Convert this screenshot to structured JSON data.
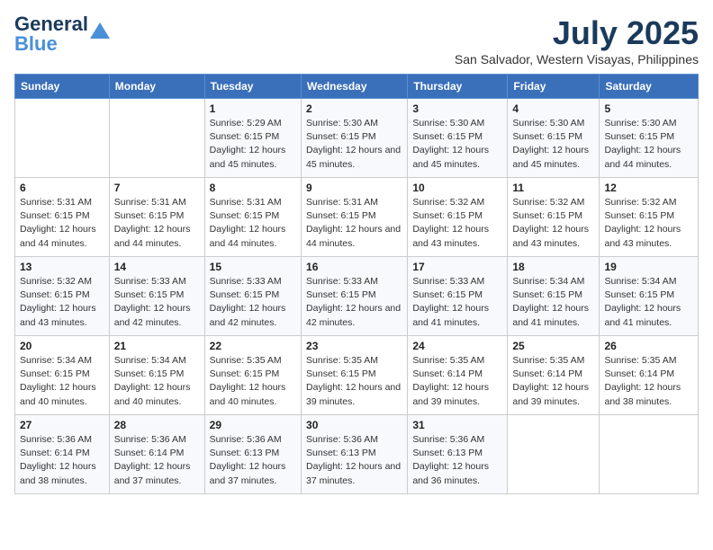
{
  "header": {
    "logo_line1": "General",
    "logo_line2": "Blue",
    "title": "July 2025",
    "subtitle": "San Salvador, Western Visayas, Philippines"
  },
  "calendar": {
    "columns": [
      "Sunday",
      "Monday",
      "Tuesday",
      "Wednesday",
      "Thursday",
      "Friday",
      "Saturday"
    ],
    "weeks": [
      [
        {
          "day": "",
          "info": ""
        },
        {
          "day": "",
          "info": ""
        },
        {
          "day": "1",
          "info": "Sunrise: 5:29 AM\nSunset: 6:15 PM\nDaylight: 12 hours and 45 minutes."
        },
        {
          "day": "2",
          "info": "Sunrise: 5:30 AM\nSunset: 6:15 PM\nDaylight: 12 hours and 45 minutes."
        },
        {
          "day": "3",
          "info": "Sunrise: 5:30 AM\nSunset: 6:15 PM\nDaylight: 12 hours and 45 minutes."
        },
        {
          "day": "4",
          "info": "Sunrise: 5:30 AM\nSunset: 6:15 PM\nDaylight: 12 hours and 45 minutes."
        },
        {
          "day": "5",
          "info": "Sunrise: 5:30 AM\nSunset: 6:15 PM\nDaylight: 12 hours and 44 minutes."
        }
      ],
      [
        {
          "day": "6",
          "info": "Sunrise: 5:31 AM\nSunset: 6:15 PM\nDaylight: 12 hours and 44 minutes."
        },
        {
          "day": "7",
          "info": "Sunrise: 5:31 AM\nSunset: 6:15 PM\nDaylight: 12 hours and 44 minutes."
        },
        {
          "day": "8",
          "info": "Sunrise: 5:31 AM\nSunset: 6:15 PM\nDaylight: 12 hours and 44 minutes."
        },
        {
          "day": "9",
          "info": "Sunrise: 5:31 AM\nSunset: 6:15 PM\nDaylight: 12 hours and 44 minutes."
        },
        {
          "day": "10",
          "info": "Sunrise: 5:32 AM\nSunset: 6:15 PM\nDaylight: 12 hours and 43 minutes."
        },
        {
          "day": "11",
          "info": "Sunrise: 5:32 AM\nSunset: 6:15 PM\nDaylight: 12 hours and 43 minutes."
        },
        {
          "day": "12",
          "info": "Sunrise: 5:32 AM\nSunset: 6:15 PM\nDaylight: 12 hours and 43 minutes."
        }
      ],
      [
        {
          "day": "13",
          "info": "Sunrise: 5:32 AM\nSunset: 6:15 PM\nDaylight: 12 hours and 43 minutes."
        },
        {
          "day": "14",
          "info": "Sunrise: 5:33 AM\nSunset: 6:15 PM\nDaylight: 12 hours and 42 minutes."
        },
        {
          "day": "15",
          "info": "Sunrise: 5:33 AM\nSunset: 6:15 PM\nDaylight: 12 hours and 42 minutes."
        },
        {
          "day": "16",
          "info": "Sunrise: 5:33 AM\nSunset: 6:15 PM\nDaylight: 12 hours and 42 minutes."
        },
        {
          "day": "17",
          "info": "Sunrise: 5:33 AM\nSunset: 6:15 PM\nDaylight: 12 hours and 41 minutes."
        },
        {
          "day": "18",
          "info": "Sunrise: 5:34 AM\nSunset: 6:15 PM\nDaylight: 12 hours and 41 minutes."
        },
        {
          "day": "19",
          "info": "Sunrise: 5:34 AM\nSunset: 6:15 PM\nDaylight: 12 hours and 41 minutes."
        }
      ],
      [
        {
          "day": "20",
          "info": "Sunrise: 5:34 AM\nSunset: 6:15 PM\nDaylight: 12 hours and 40 minutes."
        },
        {
          "day": "21",
          "info": "Sunrise: 5:34 AM\nSunset: 6:15 PM\nDaylight: 12 hours and 40 minutes."
        },
        {
          "day": "22",
          "info": "Sunrise: 5:35 AM\nSunset: 6:15 PM\nDaylight: 12 hours and 40 minutes."
        },
        {
          "day": "23",
          "info": "Sunrise: 5:35 AM\nSunset: 6:15 PM\nDaylight: 12 hours and 39 minutes."
        },
        {
          "day": "24",
          "info": "Sunrise: 5:35 AM\nSunset: 6:14 PM\nDaylight: 12 hours and 39 minutes."
        },
        {
          "day": "25",
          "info": "Sunrise: 5:35 AM\nSunset: 6:14 PM\nDaylight: 12 hours and 39 minutes."
        },
        {
          "day": "26",
          "info": "Sunrise: 5:35 AM\nSunset: 6:14 PM\nDaylight: 12 hours and 38 minutes."
        }
      ],
      [
        {
          "day": "27",
          "info": "Sunrise: 5:36 AM\nSunset: 6:14 PM\nDaylight: 12 hours and 38 minutes."
        },
        {
          "day": "28",
          "info": "Sunrise: 5:36 AM\nSunset: 6:14 PM\nDaylight: 12 hours and 37 minutes."
        },
        {
          "day": "29",
          "info": "Sunrise: 5:36 AM\nSunset: 6:13 PM\nDaylight: 12 hours and 37 minutes."
        },
        {
          "day": "30",
          "info": "Sunrise: 5:36 AM\nSunset: 6:13 PM\nDaylight: 12 hours and 37 minutes."
        },
        {
          "day": "31",
          "info": "Sunrise: 5:36 AM\nSunset: 6:13 PM\nDaylight: 12 hours and 36 minutes."
        },
        {
          "day": "",
          "info": ""
        },
        {
          "day": "",
          "info": ""
        }
      ]
    ]
  }
}
